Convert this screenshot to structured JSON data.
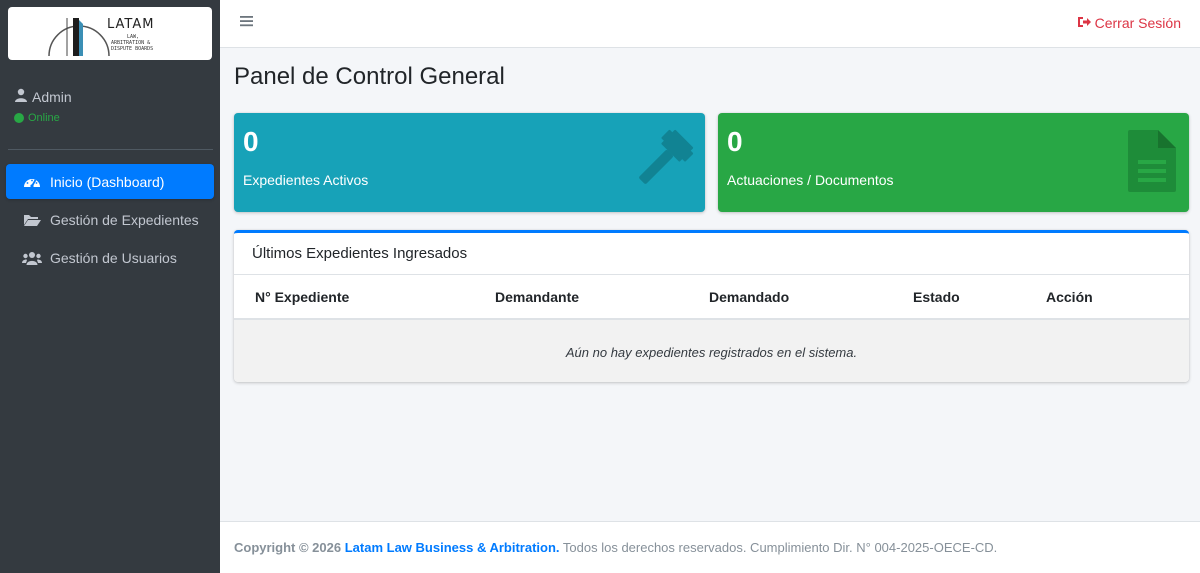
{
  "brand": {
    "logo_title": "LATAM",
    "logo_line1": "LAW,",
    "logo_line2": "ARBITRATION &",
    "logo_line3": "DISPUTE BOARDS"
  },
  "user": {
    "name": "Admin",
    "status": "Online"
  },
  "sidebar": {
    "items": [
      {
        "label": "Inicio (Dashboard)",
        "icon": "dashboard-gauge-icon",
        "active": true
      },
      {
        "label": "Gestión de Expedientes",
        "icon": "folder-open-icon",
        "active": false
      },
      {
        "label": "Gestión de Usuarios",
        "icon": "users-icon",
        "active": false
      }
    ]
  },
  "navbar": {
    "menu_icon": "hamburger-menu-icon",
    "logout_label": "Cerrar Sesión",
    "logout_icon": "sign-out-icon"
  },
  "page": {
    "title": "Panel de Control General"
  },
  "stats": [
    {
      "count": "0",
      "label": "Expedientes Activos",
      "icon": "gavel-icon",
      "color": "#17a2b8"
    },
    {
      "count": "0",
      "label": "Actuaciones / Documentos",
      "icon": "file-document-icon",
      "color": "#28a745"
    }
  ],
  "recent": {
    "title": "Últimos Expedientes Ingresados",
    "columns": [
      "N° Expediente",
      "Demandante",
      "Demandado",
      "Estado",
      "Acción"
    ],
    "empty_message": "Aún no hay expedientes registrados en el sistema."
  },
  "footer": {
    "copyright": "Copyright © 2026",
    "company": "Latam Law Business & Arbitration.",
    "rights": "Todos los derechos reservados. Cumplimiento Dir. N° 004-2025-OECE-CD."
  },
  "colors": {
    "primary": "#007bff",
    "info": "#17a2b8",
    "success": "#28a745",
    "danger": "#dc3545",
    "sidebar_bg": "#343a40"
  }
}
